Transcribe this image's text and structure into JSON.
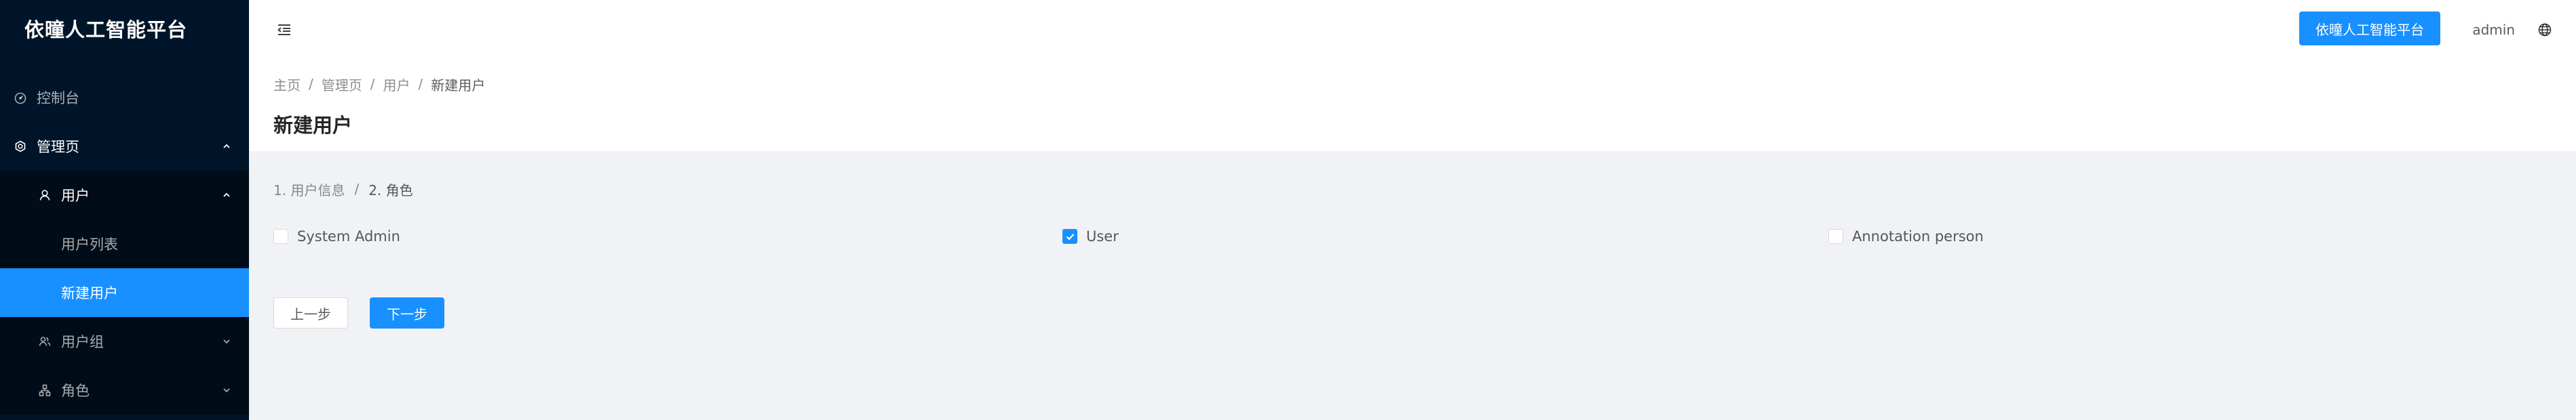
{
  "app": {
    "title": "依曈人工智能平台"
  },
  "colors": {
    "sidebar_bg": "#001529",
    "accent": "#1890ff",
    "content_bg": "#f0f2f5"
  },
  "sidebar": {
    "items": [
      {
        "label": "控制台",
        "icon": "dashboard-icon",
        "level": 1
      },
      {
        "label": "管理页",
        "icon": "setting-icon",
        "level": 1,
        "expanded": true
      },
      {
        "label": "用户",
        "icon": "user-icon",
        "level": 2,
        "expanded": true
      },
      {
        "label": "用户列表",
        "level": 3
      },
      {
        "label": "新建用户",
        "level": 3,
        "active": true
      },
      {
        "label": "用户组",
        "icon": "team-icon",
        "level": 2,
        "expanded": false
      },
      {
        "label": "角色",
        "icon": "cluster-icon",
        "level": 2,
        "expanded": false
      }
    ]
  },
  "header": {
    "platform_button": "依曈人工智能平台",
    "username": "admin",
    "icons": [
      "menu-fold-icon",
      "globe-icon"
    ]
  },
  "breadcrumb": [
    "主页",
    "管理页",
    "用户",
    "新建用户"
  ],
  "page": {
    "title": "新建用户"
  },
  "steps": [
    "1. 用户信息",
    "2. 角色"
  ],
  "roles": [
    {
      "label": "System Admin",
      "checked": false
    },
    {
      "label": "User",
      "checked": true
    },
    {
      "label": "Annotation person",
      "checked": false
    }
  ],
  "buttons": {
    "prev": "上一步",
    "next": "下一步"
  }
}
